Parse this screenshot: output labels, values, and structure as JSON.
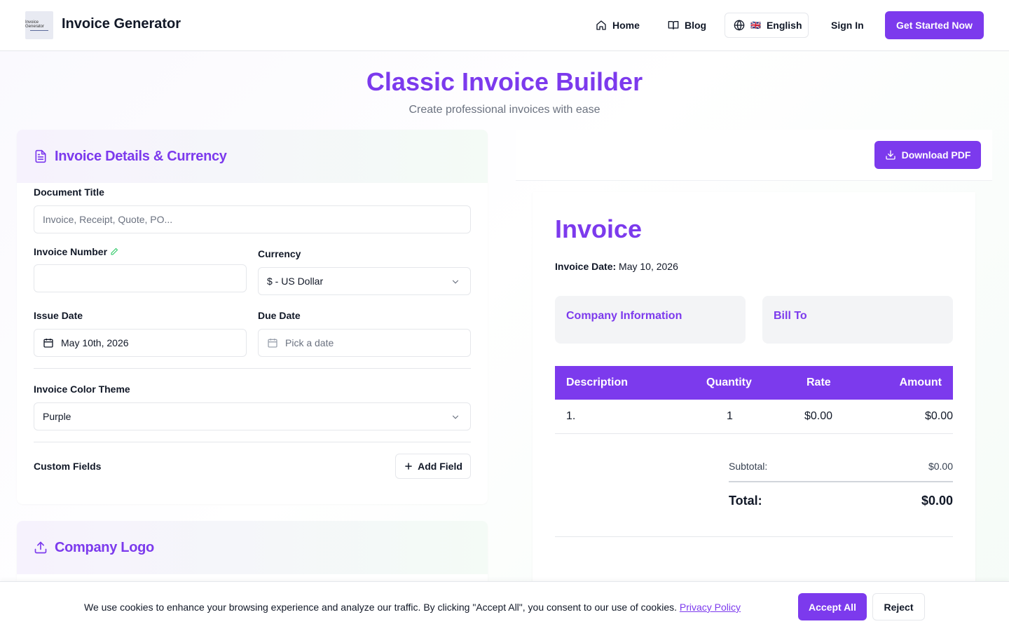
{
  "header": {
    "logo_text": "Invoice Generator",
    "brand": "Invoice Generator",
    "nav": {
      "home": "Home",
      "blog": "Blog",
      "language_flag": "🇬🇧",
      "language": "English",
      "sign_in": "Sign In",
      "get_started": "Get Started Now"
    }
  },
  "page": {
    "title": "Classic Invoice Builder",
    "subtitle": "Create professional invoices with ease"
  },
  "details_card": {
    "title": "Invoice Details & Currency",
    "icon": "document-icon",
    "document_title_label": "Document Title",
    "document_title_value": "",
    "document_title_placeholder": "Invoice, Receipt, Quote, PO...",
    "invoice_number_label": "Invoice Number",
    "invoice_number_value": "",
    "currency_label": "Currency",
    "currency_value": "$ - US Dollar",
    "issue_date_label": "Issue Date",
    "issue_date_value": "May 10th, 2026",
    "due_date_label": "Due Date",
    "due_date_placeholder": "Pick a date",
    "color_theme_label": "Invoice Color Theme",
    "color_theme_value": "Purple",
    "custom_fields_label": "Custom Fields",
    "add_field_label": "Add Field"
  },
  "logo_card": {
    "title": "Company Logo",
    "icon": "upload-icon"
  },
  "preview": {
    "download_label": "Download PDF",
    "invoice_title": "Invoice",
    "invoice_date_label": "Invoice Date:",
    "invoice_date_value": "May 10, 2026",
    "company_info_label": "Company Information",
    "bill_to_label": "Bill To",
    "table_headers": {
      "description": "Description",
      "quantity": "Quantity",
      "rate": "Rate",
      "amount": "Amount"
    },
    "rows": [
      {
        "description": "1.",
        "quantity": "1",
        "rate": "$0.00",
        "amount": "$0.00"
      }
    ],
    "subtotal_label": "Subtotal:",
    "subtotal_value": "$0.00",
    "total_label": "Total:",
    "total_value": "$0.00"
  },
  "cookie": {
    "text": "We use cookies to enhance your browsing experience and analyze our traffic. By clicking \"Accept All\", you consent to our use of cookies.",
    "privacy_link": "Privacy Policy",
    "accept": "Accept All",
    "reject": "Reject"
  },
  "colors": {
    "accent": "#7c3aed",
    "text": "#111827",
    "muted": "#6b7280",
    "border": "#e5e7eb"
  }
}
